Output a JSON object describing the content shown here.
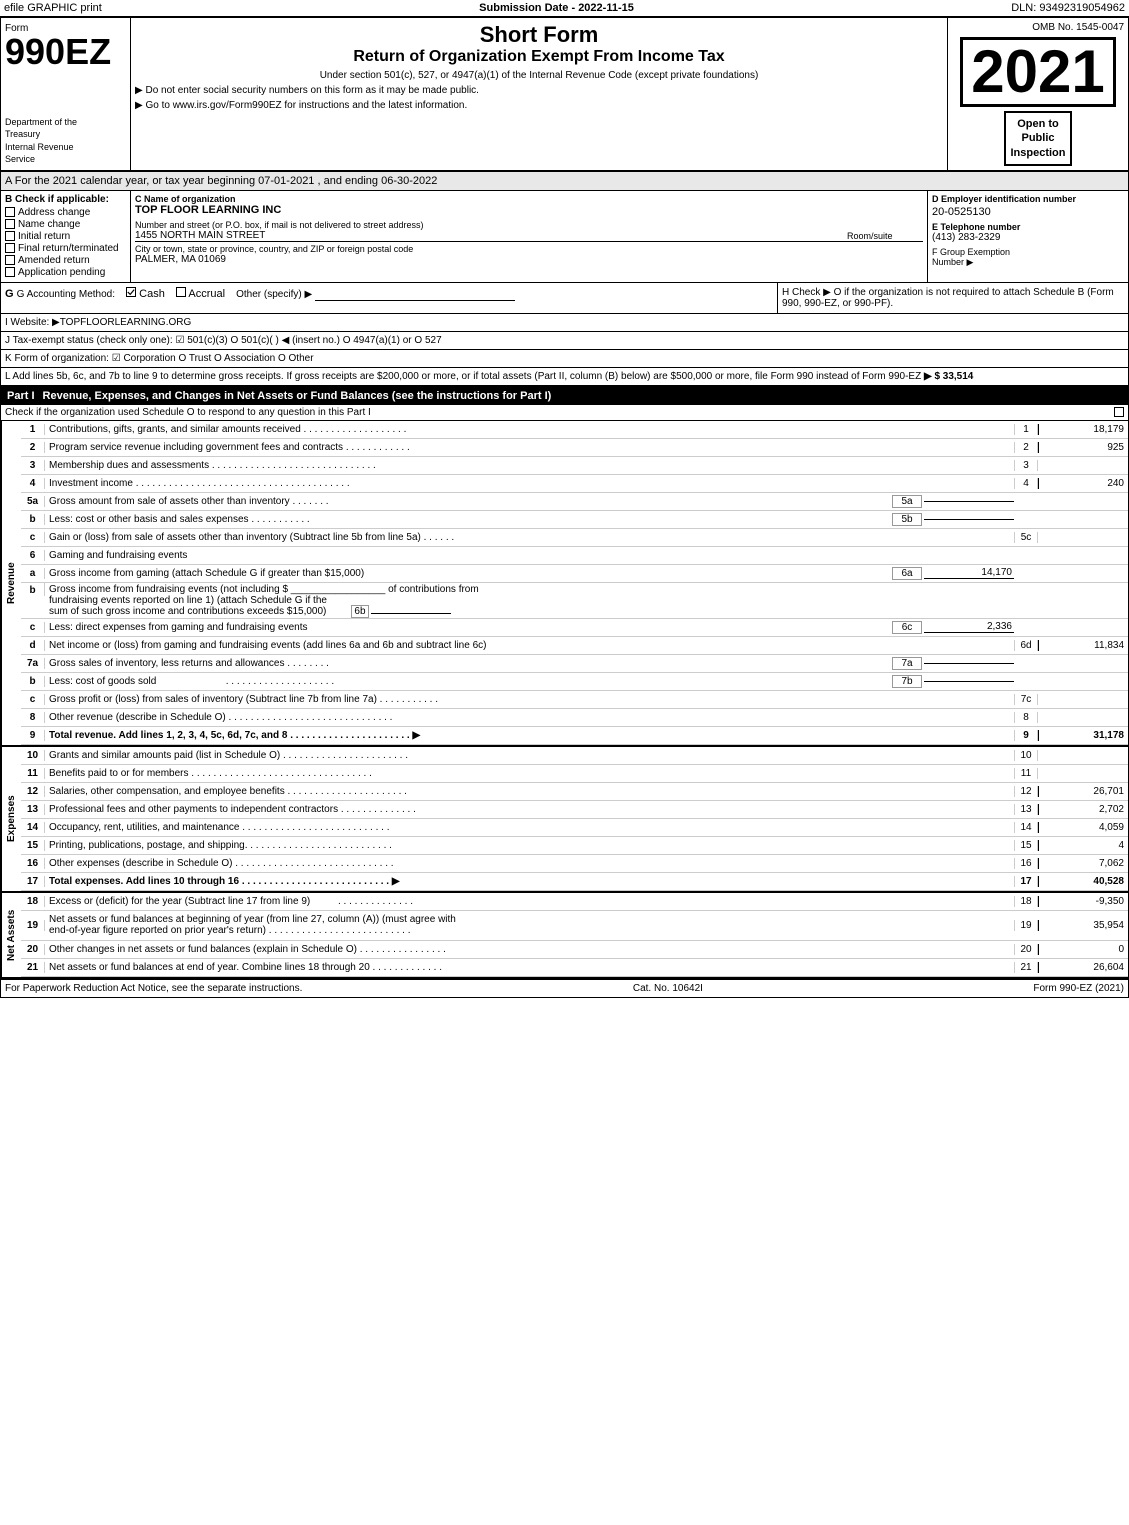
{
  "topbar": {
    "left": "efile GRAPHIC print",
    "center": "Submission Date - 2022-11-15",
    "right": "DLN: 93492319054962"
  },
  "form": {
    "number": "990EZ",
    "form_label": "Form",
    "dept_line1": "Department of the",
    "dept_line2": "Treasury",
    "dept_line3": "Internal Revenue",
    "dept_line4": "Service",
    "title_short": "Short Form",
    "title_return": "Return of Organization Exempt From Income Tax",
    "subtitle": "Under section 501(c), 527, or 4947(a)(1) of the Internal Revenue Code (except private foundations)",
    "notice1": "▶ Do not enter social security numbers on this form as it may be made public.",
    "notice2": "▶ Go to www.irs.gov/Form990EZ for instructions and the latest information.",
    "omb": "OMB No. 1545-0047",
    "year": "2021",
    "open_to_public": "Open to\nPublic\nInspection",
    "section_a": "A For the 2021 calendar year, or tax year beginning 07-01-2021 , and ending 06-30-2022",
    "check_if_applicable_label": "B Check if applicable:",
    "check_items": [
      {
        "label": "Address change",
        "checked": false
      },
      {
        "label": "Name change",
        "checked": false
      },
      {
        "label": "Initial return",
        "checked": false
      },
      {
        "label": "Final return/terminated",
        "checked": false
      },
      {
        "label": "Amended return",
        "checked": false
      },
      {
        "label": "Application pending",
        "checked": false
      }
    ],
    "c_label": "C Name of organization",
    "org_name": "TOP FLOOR LEARNING INC",
    "address_label": "Number and street (or P.O. box, if mail is not delivered to street address)",
    "address_value": "1455 NORTH MAIN STREET",
    "room_label": "Room/suite",
    "city_label": "City or town, state or province, country, and ZIP or foreign postal code",
    "city_value": "PALMER, MA  01069",
    "d_label": "D Employer identification number",
    "ein": "20-0525130",
    "e_label": "E Telephone number",
    "phone": "(413) 283-2329",
    "f_label": "F Group Exemption",
    "f_label2": "Number",
    "accounting_method": "G Accounting Method:",
    "cash_checked": true,
    "accrual_checked": false,
    "other_specify": "Other (specify) ▶",
    "h_check": "H  Check ▶  O if the organization is not required to attach Schedule B (Form 990, 990-EZ, or 990-PF).",
    "i_website": "I Website: ▶TOPFLOORLEARNING.ORG",
    "j_tax_exempt": "J Tax-exempt status (check only one): ☑ 501(c)(3) O 501(c)(  ) ◀ (insert no.) O 4947(a)(1) or O 527",
    "k_form": "K Form of organization: ☑ Corporation  O Trust  O Association  O Other",
    "l_text": "L Add lines 5b, 6c, and 7b to line 9 to determine gross receipts. If gross receipts are $200,000 or more, or if total assets (Part II, column (B) below) are $500,000 or more, file Form 990 instead of Form 990-EZ",
    "l_amount": "▶ $ 33,514",
    "part1_label": "Part I",
    "part1_title": "Revenue, Expenses, and Changes in Net Assets or Fund Balances (see the instructions for Part I)",
    "part1_check_text": "Check if the organization used Schedule O to respond to any question in this Part I",
    "revenue_rows": [
      {
        "line": "1",
        "desc": "Contributions, gifts, grants, and similar amounts received",
        "dots": true,
        "line_col": "1",
        "amount": "18,179"
      },
      {
        "line": "2",
        "desc": "Program service revenue including government fees and contracts",
        "dots": true,
        "line_col": "2",
        "amount": "925"
      },
      {
        "line": "3",
        "desc": "Membership dues and assessments",
        "dots": true,
        "line_col": "3",
        "amount": ""
      },
      {
        "line": "4",
        "desc": "Investment income",
        "dots": true,
        "line_col": "4",
        "amount": "240"
      },
      {
        "line": "5a",
        "desc": "Gross amount from sale of assets other than inventory",
        "sub_label": "5a",
        "sub_val": "",
        "line_col": "",
        "amount": ""
      },
      {
        "line": "b",
        "desc": "Less: cost or other basis and sales expenses",
        "sub_label": "5b",
        "sub_val": "",
        "line_col": "",
        "amount": ""
      },
      {
        "line": "c",
        "desc": "Gain or (loss) from sale of assets other than inventory (Subtract line 5b from line 5a)",
        "dots": true,
        "line_col": "5c",
        "amount": ""
      },
      {
        "line": "6",
        "desc": "Gaming and fundraising events",
        "line_col": "",
        "amount": ""
      },
      {
        "line": "a",
        "desc": "Gross income from gaming (attach Schedule G if greater than $15,000)",
        "sub_label": "6a",
        "sub_val": "14,170",
        "line_col": "",
        "amount": ""
      },
      {
        "line": "b",
        "desc": "Gross income from fundraising events (not including $ _____________ of contributions from fundraising events reported on line 1) (attach Schedule G if the sum of such gross income and contributions exceeds $15,000)",
        "sub_label": "6b",
        "sub_val": "",
        "line_col": "",
        "amount": ""
      },
      {
        "line": "c",
        "desc": "Less: direct expenses from gaming and fundraising events",
        "sub_label": "6c",
        "sub_val": "2,336",
        "line_col": "",
        "amount": ""
      },
      {
        "line": "d",
        "desc": "Net income or (loss) from gaming and fundraising events (add lines 6a and 6b and subtract line 6c)",
        "dots": false,
        "line_col": "6d",
        "amount": "11,834"
      },
      {
        "line": "7a",
        "desc": "Gross sales of inventory, less returns and allowances",
        "sub_label": "7a",
        "sub_val": "",
        "line_col": "",
        "amount": ""
      },
      {
        "line": "b",
        "desc": "Less: cost of goods sold",
        "sub_label": "7b",
        "sub_val": "",
        "line_col": "",
        "amount": ""
      },
      {
        "line": "c",
        "desc": "Gross profit or (loss) from sales of inventory (Subtract line 7b from line 7a)",
        "dots": true,
        "line_col": "7c",
        "amount": ""
      },
      {
        "line": "8",
        "desc": "Other revenue (describe in Schedule O)",
        "dots": true,
        "line_col": "8",
        "amount": ""
      },
      {
        "line": "9",
        "desc": "Total revenue. Add lines 1, 2, 3, 4, 5c, 6d, 7c, and 8",
        "dots": true,
        "is_total": true,
        "arrow": "▶",
        "line_col": "9",
        "amount": "31,178"
      }
    ],
    "expenses_rows": [
      {
        "line": "10",
        "desc": "Grants and similar amounts paid (list in Schedule O)",
        "dots": true,
        "line_col": "10",
        "amount": ""
      },
      {
        "line": "11",
        "desc": "Benefits paid to or for members",
        "dots": true,
        "line_col": "11",
        "amount": ""
      },
      {
        "line": "12",
        "desc": "Salaries, other compensation, and employee benefits",
        "dots": true,
        "line_col": "12",
        "amount": "26,701"
      },
      {
        "line": "13",
        "desc": "Professional fees and other payments to independent contractors",
        "dots": true,
        "line_col": "13",
        "amount": "2,702"
      },
      {
        "line": "14",
        "desc": "Occupancy, rent, utilities, and maintenance",
        "dots": true,
        "line_col": "14",
        "amount": "4,059"
      },
      {
        "line": "15",
        "desc": "Printing, publications, postage, and shipping",
        "dots": true,
        "line_col": "15",
        "amount": "4"
      },
      {
        "line": "16",
        "desc": "Other expenses (describe in Schedule O)",
        "dots": true,
        "line_col": "16",
        "amount": "7,062"
      },
      {
        "line": "17",
        "desc": "Total expenses. Add lines 10 through 16",
        "dots": true,
        "is_total": true,
        "arrow": "▶",
        "line_col": "17",
        "amount": "40,528"
      }
    ],
    "net_assets_rows": [
      {
        "line": "18",
        "desc": "Excess or (deficit) for the year (Subtract line 17 from line 9)",
        "dots": true,
        "line_col": "18",
        "amount": "-9,350"
      },
      {
        "line": "19",
        "desc": "Net assets or fund balances at beginning of year (from line 27, column (A)) (must agree with end-of-year figure reported on prior year's return)",
        "dots": true,
        "line_col": "19",
        "amount": "35,954"
      },
      {
        "line": "20",
        "desc": "Other changes in net assets or fund balances (explain in Schedule O)",
        "dots": true,
        "line_col": "20",
        "amount": "0"
      },
      {
        "line": "21",
        "desc": "Net assets or fund balances at end of year. Combine lines 18 through 20",
        "dots": true,
        "line_col": "21",
        "amount": "26,604"
      }
    ],
    "footer_left": "For Paperwork Reduction Act Notice, see the separate instructions.",
    "footer_center": "Cat. No. 10642I",
    "footer_right": "Form 990-EZ (2021)"
  }
}
